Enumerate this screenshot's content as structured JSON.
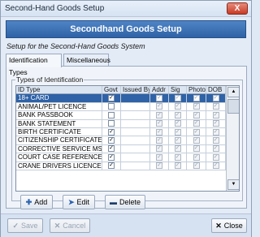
{
  "window": {
    "title": "Second-Hand Goods Setup",
    "close_glyph": "X"
  },
  "banner": "Secondhand Goods Setup",
  "subtitle": "Setup for the Second-Hand Goods System",
  "tabs": [
    {
      "label": "Identification Types"
    },
    {
      "label": "Miscellaneous"
    }
  ],
  "group_label": "Types of Identification",
  "columns": [
    "ID Type",
    "Govt",
    "Issued By",
    "Addr",
    "Sig",
    "Photo",
    "DOB"
  ],
  "rows": [
    {
      "name": "18+ CARD",
      "govt": true,
      "addr": true,
      "sig": true,
      "photo": true,
      "dob": true
    },
    {
      "name": "ANIMAL/PET LICENCE",
      "govt": false,
      "addr": true,
      "sig": true,
      "photo": true,
      "dob": true
    },
    {
      "name": "BANK PASSBOOK",
      "govt": false,
      "addr": true,
      "sig": true,
      "photo": true,
      "dob": true
    },
    {
      "name": "BANK STATEMENT",
      "govt": false,
      "addr": true,
      "sig": true,
      "photo": true,
      "dob": true
    },
    {
      "name": "BIRTH CERTIFICATE",
      "govt": true,
      "addr": true,
      "sig": true,
      "photo": true,
      "dob": true
    },
    {
      "name": "CITIZENSHIP CERTIFICATE",
      "govt": true,
      "addr": true,
      "sig": true,
      "photo": true,
      "dob": true
    },
    {
      "name": "CORRECTIVE SERVICE MST IDX",
      "govt": true,
      "addr": true,
      "sig": true,
      "photo": true,
      "dob": true
    },
    {
      "name": "COURT CASE REFERENCE NUMI",
      "govt": true,
      "addr": true,
      "sig": true,
      "photo": true,
      "dob": true
    },
    {
      "name": "CRANE DRIVERS LICENCE",
      "govt": true,
      "addr": true,
      "sig": true,
      "photo": true,
      "dob": true
    }
  ],
  "checkmark": "✓",
  "actions": {
    "add": "Add",
    "edit": "Edit",
    "delete": "Delete"
  },
  "footer": {
    "save": "Save",
    "cancel": "Cancel",
    "close": "Close"
  },
  "colors": {
    "banner": "#2f62a6",
    "selection": "#2f62a6"
  }
}
